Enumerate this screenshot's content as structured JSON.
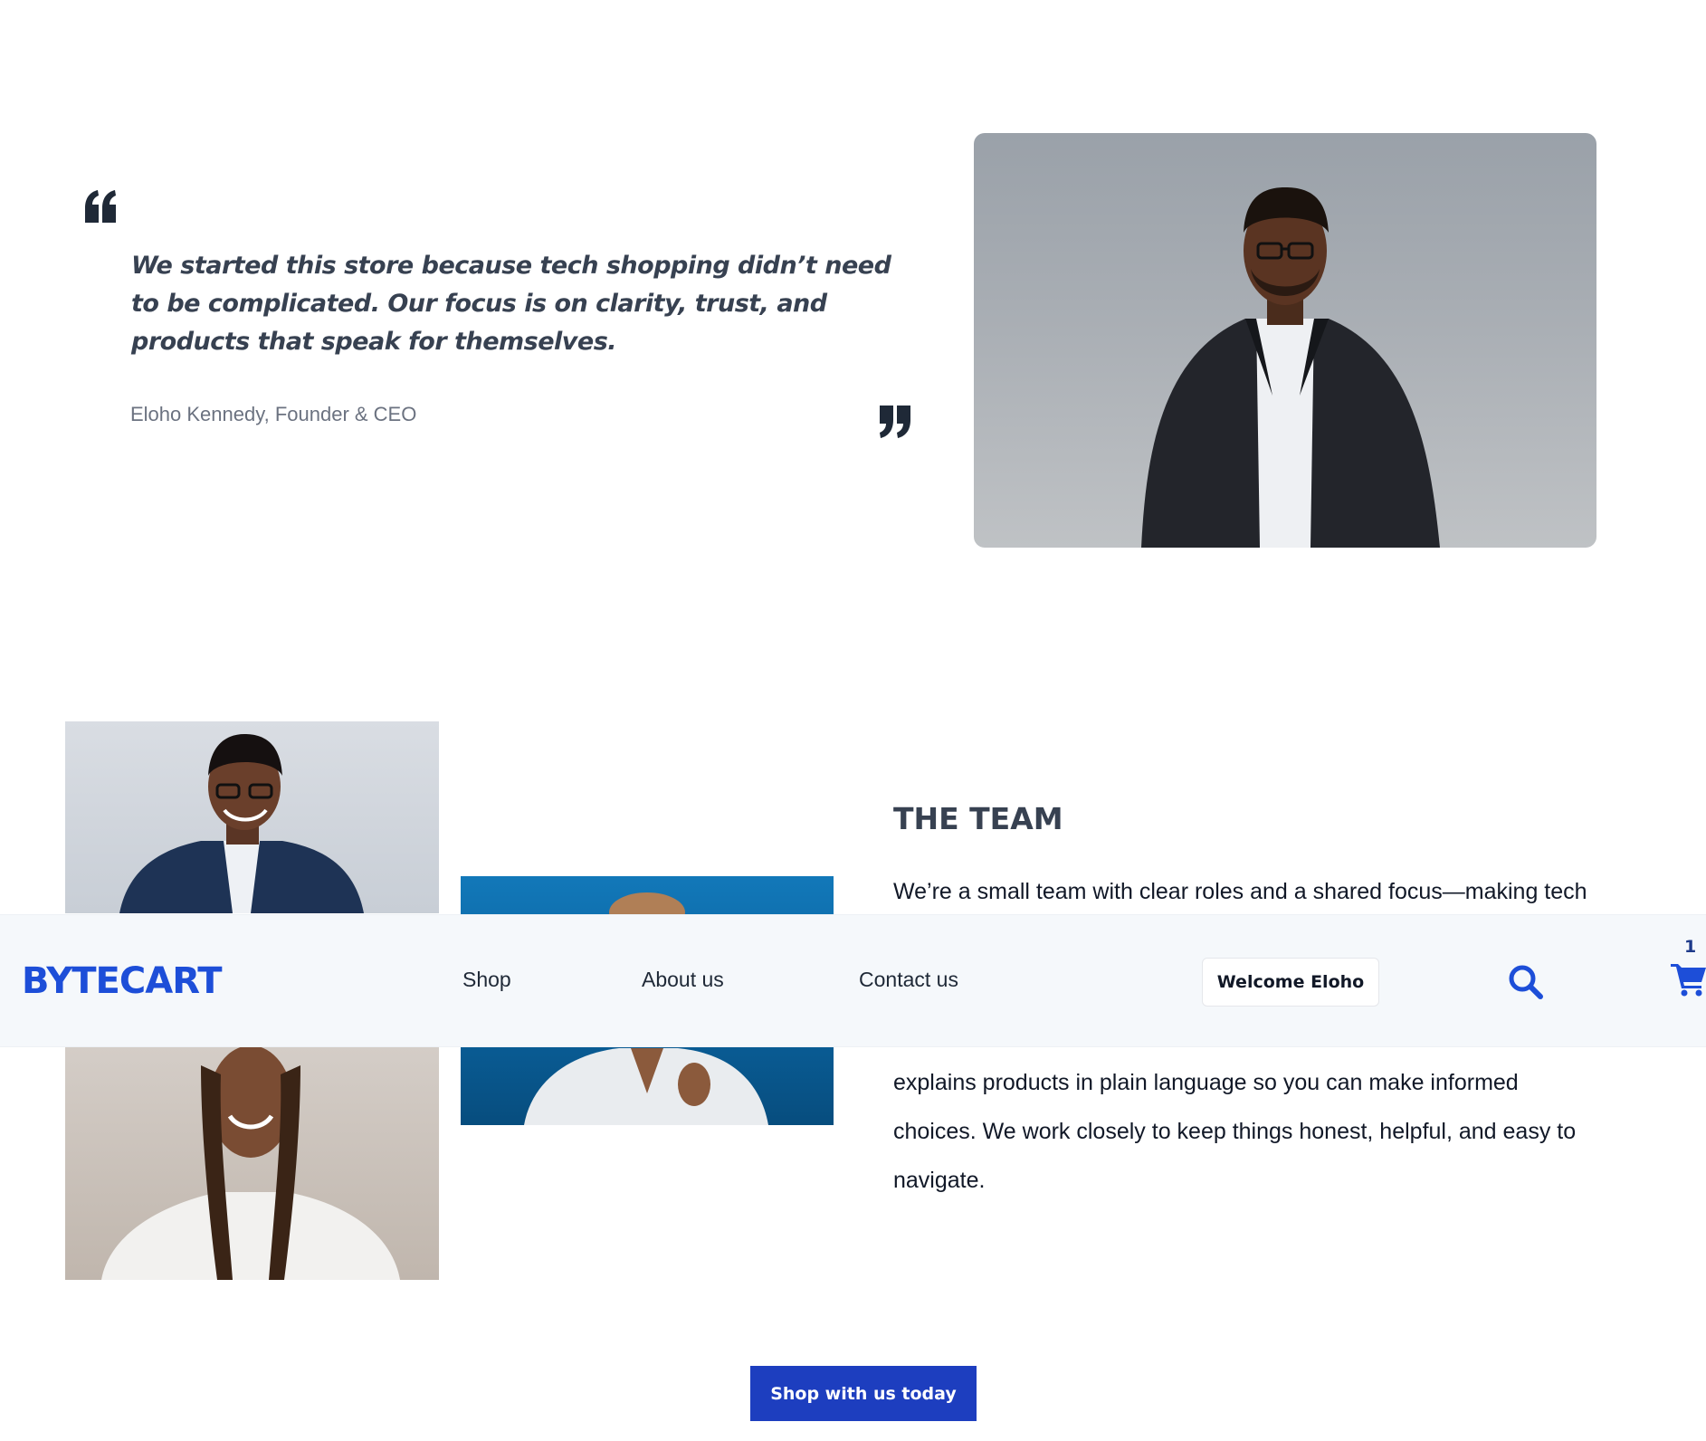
{
  "quote": {
    "text": "We started this store because tech shopping didn’t need to be complicated. Our focus is on clarity, trust, and products that speak for themselves.",
    "author": "Eloho Kennedy, Founder & CEO",
    "open_icon": "quote-open-icon",
    "close_icon": "quote-close-icon"
  },
  "team": {
    "title": "THE TEAM",
    "text_line_1": "We’re a small team with clear roles and a shared focus—making tech",
    "text_lines_bottom": [
      "explains products in plain language so you can make informed",
      "choices. We work closely to keep things honest, helpful, and easy to",
      "navigate."
    ]
  },
  "cta": {
    "label": "Shop with us today"
  },
  "navbar": {
    "logo": "BYTECART",
    "links": [
      "Shop",
      "About us",
      "Contact us"
    ],
    "welcome_label": "Welcome Eloho",
    "search_icon": "search-icon",
    "cart_icon": "cart-icon",
    "cart_count": "1"
  },
  "colors": {
    "brand": "#1d4ed8",
    "cta": "#1d3ebf",
    "navbar_bg": "#f5f8fb",
    "quote_text": "#374151"
  }
}
